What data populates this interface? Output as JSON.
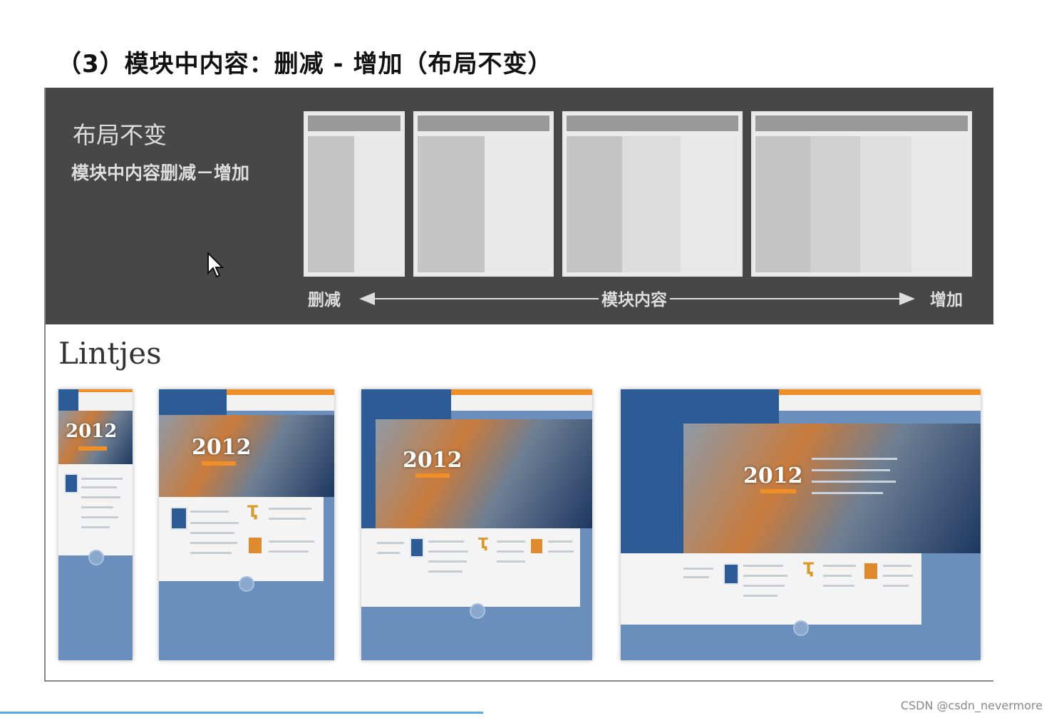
{
  "slide": {
    "title": "（3）模块中内容：删减 - 增加（布局不变）",
    "panel_heading": "布局不变",
    "panel_subheading": "模块中内容删减－增加",
    "axis_left": "删减",
    "axis_center": "模块内容",
    "axis_right": "增加",
    "brand": "Lintjes",
    "hero_year": "2012",
    "watermark": "CSDN @csdn_nevermore"
  },
  "colors": {
    "panel_bg": "#474747",
    "accent_orange": "#ee8f2a",
    "brand_blue": "#2c5b95",
    "footer_blue": "#6a8fbd"
  }
}
